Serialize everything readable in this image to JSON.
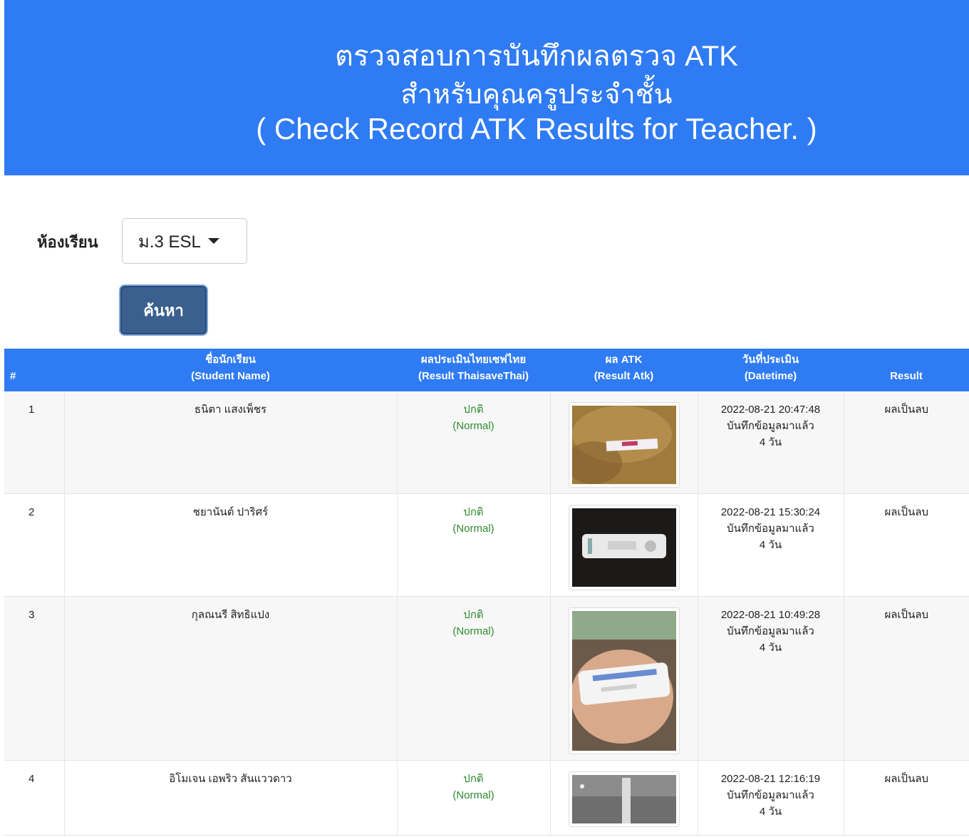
{
  "header": {
    "title_th": "ตรวจสอบการบันทึกผลตรวจ ATK",
    "subtitle_th": "สำหรับคุณครูประจำชั้น",
    "title_en": "( Check Record ATK Results for Teacher. )"
  },
  "filter": {
    "room_label": "ห้องเรียน",
    "room_value": "ม.3 ESL",
    "search_label": "ค้นหา"
  },
  "table": {
    "headers": {
      "num": "#",
      "name_th": "ชื่อนักเรียน",
      "name_en": "(Student Name)",
      "ts_th": "ผลประเมินไทยเซฟไทย",
      "ts_en": "(Result ThaisaveThai)",
      "atk_th": "ผล ATK",
      "atk_en": "(Result Atk)",
      "date_th": "วันที่ประเมิน",
      "date_en": "(Datetime)",
      "result": "Result"
    },
    "rows": [
      {
        "num": "1",
        "name": "ธนิตา แสงเพ็ชร",
        "ts_th": "ปกติ",
        "ts_en": "(Normal)",
        "datetime": "2022-08-21 20:47:48",
        "saved": "บันทึกข้อมูลมาแล้ว",
        "days": "4 วัน",
        "result": "ผลเป็นลบ"
      },
      {
        "num": "2",
        "name": "ชยานันต์ ปาริศร์",
        "ts_th": "ปกติ",
        "ts_en": "(Normal)",
        "datetime": "2022-08-21 15:30:24",
        "saved": "บันทึกข้อมูลมาแล้ว",
        "days": "4 วัน",
        "result": "ผลเป็นลบ"
      },
      {
        "num": "3",
        "name": "กุลณนรี สิทธิแปง",
        "ts_th": "ปกติ",
        "ts_en": "(Normal)",
        "datetime": "2022-08-21 10:49:28",
        "saved": "บันทึกข้อมูลมาแล้ว",
        "days": "4 วัน",
        "result": "ผลเป็นลบ"
      },
      {
        "num": "4",
        "name": "อิโมเจน เอพริว สันแววดาว",
        "ts_th": "ปกติ",
        "ts_en": "(Normal)",
        "datetime": "2022-08-21 12:16:19",
        "saved": "บันทึกข้อมูลมาแล้ว",
        "days": "4 วัน",
        "result": "ผลเป็นลบ"
      }
    ]
  },
  "colors": {
    "primary": "#2f7bf3",
    "button": "#3b5f8e",
    "normal_text": "#2e8b2e"
  }
}
